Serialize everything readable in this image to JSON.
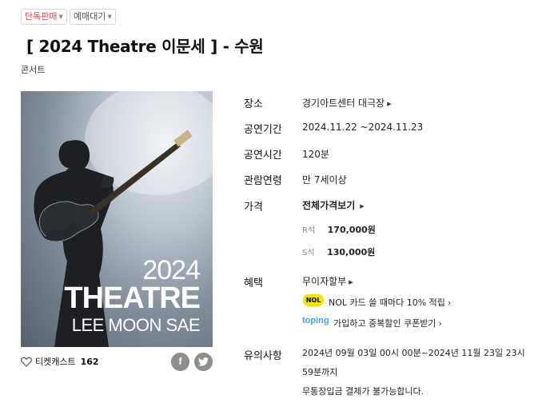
{
  "badges": {
    "exclusive": "단독판매",
    "presale": "예매대기"
  },
  "title": "[ 2024 Theatre 이문세 ]  - 수원",
  "category": "콘서트",
  "poster": {
    "year": "2024",
    "word": "THEATRE",
    "artist": "LEE MOON SAE"
  },
  "ticketcast": {
    "label": "티켓캐스트",
    "count": "162"
  },
  "share": {
    "facebook_glyph": "f",
    "twitter_glyph": "t"
  },
  "info": {
    "venue_label": "장소",
    "venue": "경기아트센터 대극장",
    "period_label": "공연기간",
    "period": "2024.11.22 ~2024.11.23",
    "runtime_label": "공연시간",
    "runtime": "120분",
    "age_label": "관람연령",
    "age": "만 7세이상",
    "price_label": "가격",
    "price_all": "전체가격보기",
    "prices": [
      {
        "seat": "R석",
        "amount": "170,000원"
      },
      {
        "seat": "S석",
        "amount": "130,000원"
      }
    ],
    "benefit_label": "혜택",
    "benefit_installment": "무이자할부",
    "nol_logo": "NOL",
    "nol_text": "NOL 카드 쓸 때마다 10% 적립",
    "toping_logo": "toping",
    "toping_text": "가입하고 중복할인 쿠폰받기",
    "notice_label": "유의사항",
    "notice_line1": "2024년 09월 03일 00시 00분~2024년 11월 23일 23시",
    "notice_line2": "59분까지",
    "notice_line3": "무통장입금 결제가 불가능합니다."
  },
  "colors": {
    "badge_red": "#ef3e43",
    "nol_yellow": "#f5e600",
    "toping_blue": "#3aa0ff"
  }
}
